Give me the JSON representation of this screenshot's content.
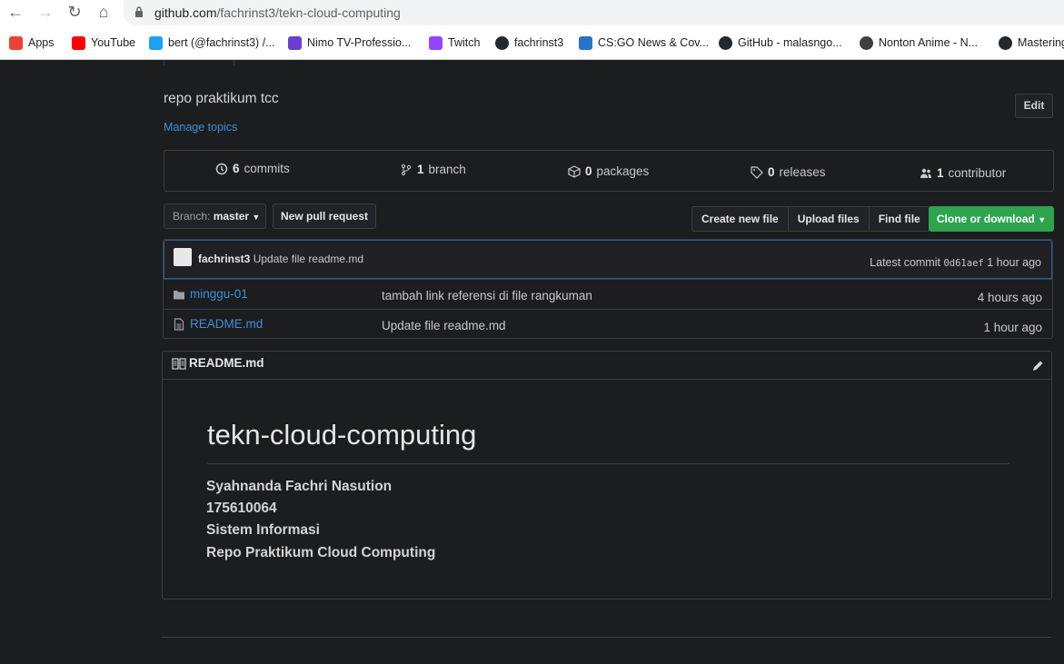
{
  "browser": {
    "url_host": "github.com",
    "url_path": "/fachrinst3/tekn-cloud-computing",
    "bookmarks": [
      {
        "label": "Apps",
        "icon": "apps-grid-icon",
        "color": "#ea4335"
      },
      {
        "label": "YouTube",
        "icon": "youtube-icon",
        "color": "#ff0000"
      },
      {
        "label": "bert (@fachrinst3) /...",
        "icon": "twitter-icon",
        "color": "#1da1f2"
      },
      {
        "label": "Nimo TV-Professio...",
        "icon": "nimo-icon",
        "color": "#6b3fd1"
      },
      {
        "label": "Twitch",
        "icon": "twitch-icon",
        "color": "#9146ff"
      },
      {
        "label": "fachrinst3",
        "icon": "github-icon",
        "color": "#24292e"
      },
      {
        "label": "CS:GO News & Cov...",
        "icon": "csgo-icon",
        "color": "#2a72c9"
      },
      {
        "label": "GitHub - malasngo...",
        "icon": "github-icon",
        "color": "#24292e"
      },
      {
        "label": "Nonton Anime - N...",
        "icon": "globe-icon",
        "color": "#3c4043"
      },
      {
        "label": "Mastering",
        "icon": "github-icon",
        "color": "#24292e"
      }
    ]
  },
  "repo": {
    "description": "repo praktikum tcc",
    "manage_topics": "Manage topics",
    "edit_label": "Edit"
  },
  "summary": {
    "commits_count": "6",
    "commits_label": "commits",
    "branch_count": "1",
    "branch_label": "branch",
    "packages_count": "0",
    "packages_label": "packages",
    "releases_count": "0",
    "releases_label": "releases",
    "contributors_count": "1",
    "contributors_label": "contributor"
  },
  "toolbar": {
    "branch_prefix": "Branch:",
    "branch_name": "master",
    "new_pr": "New pull request",
    "create_file": "Create new file",
    "upload_files": "Upload files",
    "find_file": "Find file",
    "clone": "Clone or download"
  },
  "latest_commit": {
    "author": "fachrinst3",
    "message": "Update file readme.md",
    "prefix": "Latest commit",
    "sha": "0d61aef",
    "age": "1 hour ago"
  },
  "files": [
    {
      "name": "minggu-01",
      "type": "folder",
      "message": "tambah link referensi di file rangkuman",
      "age": "4 hours ago"
    },
    {
      "name": "README.md",
      "type": "file",
      "message": "Update file readme.md",
      "age": "1 hour ago"
    }
  ],
  "readme": {
    "filename": "README.md",
    "heading": "tekn-cloud-computing",
    "lines": [
      "Syahnanda Fachri Nasution",
      "175610064",
      "Sistem Informasi",
      "Repo Praktikum Cloud Computing"
    ]
  },
  "colors": {
    "accent_link": "#3b8fd9",
    "clone_button": "#2ea44f",
    "background": "#1c1d1f"
  }
}
